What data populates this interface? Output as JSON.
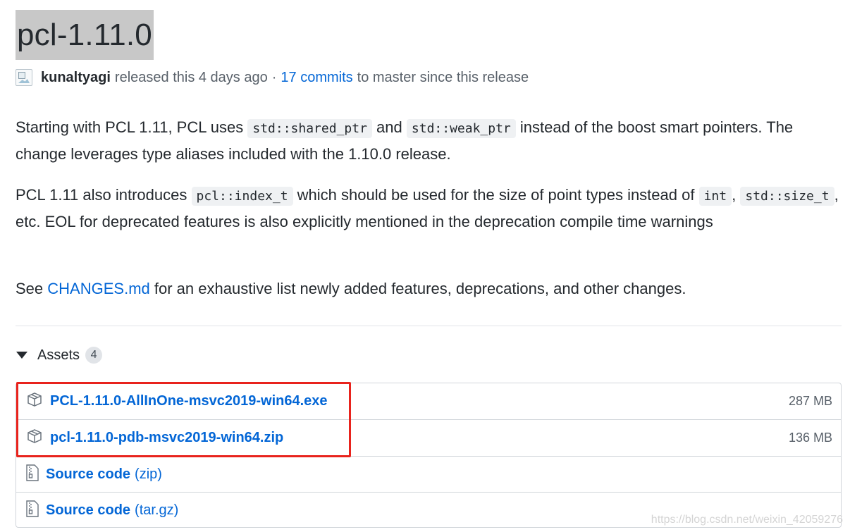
{
  "release": {
    "title": "pcl-1.11.0",
    "author": "kunaltyagi",
    "released_text": "released this 4 days ago",
    "separator": "·",
    "commits_link": "17 commits",
    "commits_suffix": "to master since this release"
  },
  "body": {
    "p1_a": "Starting with PCL 1.11, PCL uses",
    "p1_code1": "std::shared_ptr",
    "p1_b": "and",
    "p1_code2": "std::weak_ptr",
    "p1_c": "instead of the boost smart pointers. The change leverages type aliases included with the 1.10.0 release.",
    "p2_a": "PCL 1.11 also introduces",
    "p2_code1": "pcl::index_t",
    "p2_b": "which should be used for the size of point types instead of",
    "p2_code2": "int",
    "p2_c": ",",
    "p2_code3": "std::size_t",
    "p2_d": ", etc. EOL for deprecated features is also explicitly mentioned in the deprecation compile time warnings",
    "p3_a": "See",
    "p3_link": "CHANGES.md",
    "p3_b": "for an exhaustive list newly added features, deprecations, and other changes."
  },
  "assets": {
    "label": "Assets",
    "count": "4",
    "items": [
      {
        "name": "PCL-1.11.0-AllInOne-msvc2019-win64.exe",
        "size": "287 MB",
        "icon": "package-icon"
      },
      {
        "name": "pcl-1.11.0-pdb-msvc2019-win64.zip",
        "size": "136 MB",
        "icon": "package-icon"
      },
      {
        "name": "Source code",
        "suffix": "(zip)",
        "icon": "file-zip-icon"
      },
      {
        "name": "Source code",
        "suffix": "(tar.gz)",
        "icon": "file-zip-icon"
      }
    ]
  },
  "watermark": "https://blog.csdn.net/weixin_42059276",
  "colors": {
    "link": "#0366d6",
    "highlight": "#e8231d",
    "title_bg": "#c8c8c8"
  }
}
